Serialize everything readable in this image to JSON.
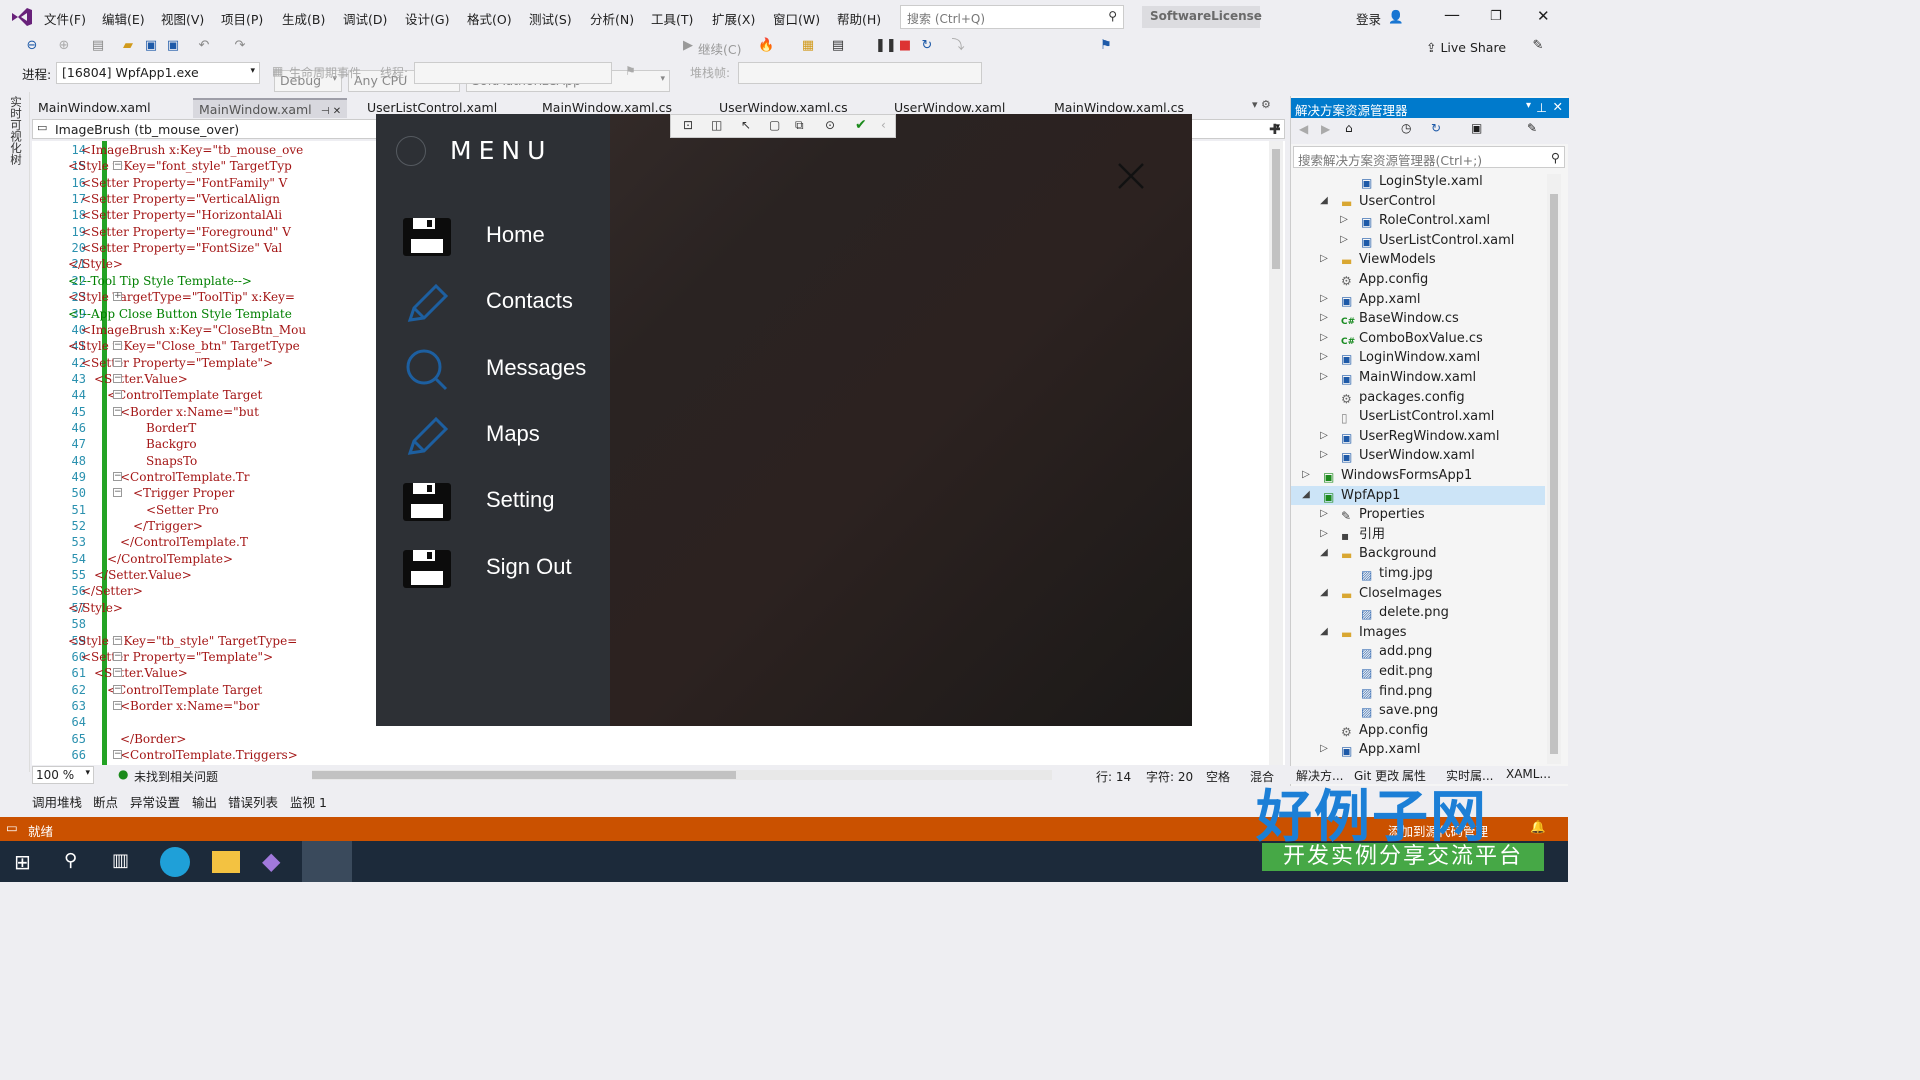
{
  "menubar": {
    "items": [
      "文件(F)",
      "编辑(E)",
      "视图(V)",
      "项目(P)",
      "生成(B)",
      "调试(D)",
      "设计(G)",
      "格式(O)",
      "测试(S)",
      "分析(N)",
      "工具(T)",
      "扩展(X)",
      "窗口(W)",
      "帮助(H)"
    ],
    "search_placeholder": "搜索 (Ctrl+Q)",
    "license": "SoftwareLicense",
    "login": "登录",
    "live_share": "Live Share"
  },
  "toolbar": {
    "config": "Debug",
    "platform": "Any CPU",
    "startup": "SoftAuthorizeApp",
    "continue": "继续(C)",
    "process_label": "进程:",
    "process_value": "[16804] WpfApp1.exe",
    "lifecycle": "生命周期事件",
    "thread_label": "线程:",
    "stack_label": "堆栈帧:"
  },
  "left_strip": {
    "label": "实时可视化树"
  },
  "tabs": [
    {
      "label": "MainWindow.xaml",
      "active": false
    },
    {
      "label": "MainWindow.xaml",
      "active": true
    },
    {
      "label": "UserListControl.xaml",
      "active": false
    },
    {
      "label": "MainWindow.xaml.cs",
      "active": false
    },
    {
      "label": "UserWindow.xaml.cs",
      "active": false
    },
    {
      "label": "UserWindow.xaml",
      "active": false
    },
    {
      "label": "MainWindow.xaml.cs",
      "active": false
    }
  ],
  "navbar": {
    "scope": "ImageBrush (tb_mouse_over)"
  },
  "code_lines": [
    {
      "n": "14",
      "indent": 3,
      "text": "<ImageBrush x:Key=\"tb_mouse_ove"
    },
    {
      "n": "15",
      "indent": 2,
      "text": "<Style x:Key=\"font_style\" TargetTyp"
    },
    {
      "n": "16",
      "indent": 3,
      "text": "<Setter Property=\"FontFamily\" V"
    },
    {
      "n": "17",
      "indent": 3,
      "text": "<Setter Property=\"VerticalAlign"
    },
    {
      "n": "18",
      "indent": 3,
      "text": "<Setter Property=\"HorizontalAli"
    },
    {
      "n": "19",
      "indent": 3,
      "text": "<Setter Property=\"Foreground\" V"
    },
    {
      "n": "20",
      "indent": 3,
      "text": "<Setter Property=\"FontSize\" Val"
    },
    {
      "n": "21",
      "indent": 2,
      "text": "</Style>"
    },
    {
      "n": "22",
      "indent": 2,
      "text": "<!--Tool Tip Style Template-->"
    },
    {
      "n": "23",
      "indent": 2,
      "text": "<Style TargetType=\"ToolTip\" x:Key="
    },
    {
      "n": "39",
      "indent": 2,
      "text": "<!--App Close Button Style Template"
    },
    {
      "n": "40",
      "indent": 3,
      "text": "<ImageBrush x:Key=\"CloseBtn_Mou"
    },
    {
      "n": "41",
      "indent": 2,
      "text": "<Style x:Key=\"Close_btn\" TargetType"
    },
    {
      "n": "42",
      "indent": 3,
      "text": "<Setter Property=\"Template\">"
    },
    {
      "n": "43",
      "indent": 4,
      "text": "<Setter.Value>"
    },
    {
      "n": "44",
      "indent": 5,
      "text": "<ControlTemplate Target"
    },
    {
      "n": "45",
      "indent": 6,
      "text": "<Border x:Name=\"but"
    },
    {
      "n": "46",
      "indent": 8,
      "text": "BorderT"
    },
    {
      "n": "47",
      "indent": 8,
      "text": "Backgro"
    },
    {
      "n": "48",
      "indent": 8,
      "text": "SnapsTo"
    },
    {
      "n": "49",
      "indent": 6,
      "text": "<ControlTemplate.Tr"
    },
    {
      "n": "50",
      "indent": 7,
      "text": "<Trigger Proper"
    },
    {
      "n": "51",
      "indent": 8,
      "text": "<Setter Pro"
    },
    {
      "n": "52",
      "indent": 7,
      "text": "</Trigger>"
    },
    {
      "n": "53",
      "indent": 6,
      "text": "</ControlTemplate.T"
    },
    {
      "n": "54",
      "indent": 5,
      "text": "</ControlTemplate>"
    },
    {
      "n": "55",
      "indent": 4,
      "text": "</Setter.Value>"
    },
    {
      "n": "56",
      "indent": 3,
      "text": "</Setter>"
    },
    {
      "n": "57",
      "indent": 2,
      "text": "</Style>"
    },
    {
      "n": "58",
      "indent": 2,
      "text": ""
    },
    {
      "n": "59",
      "indent": 2,
      "text": "<Style x:Key=\"tb_style\" TargetType="
    },
    {
      "n": "60",
      "indent": 3,
      "text": "<Setter Property=\"Template\">"
    },
    {
      "n": "61",
      "indent": 4,
      "text": "<Setter.Value>"
    },
    {
      "n": "62",
      "indent": 5,
      "text": "<ControlTemplate Target"
    },
    {
      "n": "63",
      "indent": 6,
      "text": "<Border x:Name=\"bor"
    },
    {
      "n": "64",
      "indent": 6,
      "text": ""
    },
    {
      "n": "65",
      "indent": 6,
      "text": "</Border>"
    },
    {
      "n": "66",
      "indent": 6,
      "text": "<ControlTemplate.Triggers>"
    }
  ],
  "editor_status": {
    "zoom": "100 %",
    "issues": "未找到相关问题",
    "line": "行: 14",
    "char": "字符: 20",
    "space": "空格",
    "mixed": "混合"
  },
  "bottom_tabs": [
    "调用堆栈",
    "断点",
    "异常设置",
    "输出",
    "错误列表",
    "监视 1"
  ],
  "statusbar": {
    "ready": "就绪",
    "add_source": "添加到源代码管理"
  },
  "solution": {
    "title": "解决方案资源管理器",
    "search_placeholder": "搜索解决方案资源管理器(Ctrl+;)",
    "tabs": [
      "解决方...",
      "Git 更改",
      "属性",
      "实时属...",
      "XAML..."
    ],
    "nodes": [
      {
        "label": "LoginStyle.xaml",
        "level": 4,
        "arrow": "",
        "icon": "xaml"
      },
      {
        "label": "UserControl",
        "level": 3,
        "arrow": "open",
        "icon": "folder"
      },
      {
        "label": "RoleControl.xaml",
        "level": 4,
        "arrow": "closed",
        "icon": "xaml"
      },
      {
        "label": "UserListControl.xaml",
        "level": 4,
        "arrow": "closed",
        "icon": "xaml"
      },
      {
        "label": "ViewModels",
        "level": 3,
        "arrow": "closed",
        "icon": "folder"
      },
      {
        "label": "App.config",
        "level": 3,
        "arrow": "",
        "icon": "config"
      },
      {
        "label": "App.xaml",
        "level": 3,
        "arrow": "closed",
        "icon": "xaml"
      },
      {
        "label": "BaseWindow.cs",
        "level": 3,
        "arrow": "closed",
        "icon": "cs"
      },
      {
        "label": "ComboBoxValue.cs",
        "level": 3,
        "arrow": "closed",
        "icon": "cs"
      },
      {
        "label": "LoginWindow.xaml",
        "level": 3,
        "arrow": "closed",
        "icon": "xaml"
      },
      {
        "label": "MainWindow.xaml",
        "level": 3,
        "arrow": "closed",
        "icon": "xaml"
      },
      {
        "label": "packages.config",
        "level": 3,
        "arrow": "",
        "icon": "config"
      },
      {
        "label": "UserListControl.xaml",
        "level": 3,
        "arrow": "",
        "icon": "file"
      },
      {
        "label": "UserRegWindow.xaml",
        "level": 3,
        "arrow": "closed",
        "icon": "xaml"
      },
      {
        "label": "UserWindow.xaml",
        "level": 3,
        "arrow": "closed",
        "icon": "xaml"
      },
      {
        "label": "WindowsFormsApp1",
        "level": 2,
        "arrow": "closed",
        "icon": "project"
      },
      {
        "label": "WpfApp1",
        "level": 2,
        "arrow": "open",
        "icon": "project",
        "selected": true
      },
      {
        "label": "Properties",
        "level": 3,
        "arrow": "closed",
        "icon": "wrench"
      },
      {
        "label": "引用",
        "level": 3,
        "arrow": "closed",
        "icon": "ref"
      },
      {
        "label": "Background",
        "level": 3,
        "arrow": "open",
        "icon": "folder"
      },
      {
        "label": "timg.jpg",
        "level": 4,
        "arrow": "",
        "icon": "image"
      },
      {
        "label": "CloseImages",
        "level": 3,
        "arrow": "open",
        "icon": "folder"
      },
      {
        "label": "delete.png",
        "level": 4,
        "arrow": "",
        "icon": "image"
      },
      {
        "label": "Images",
        "level": 3,
        "arrow": "open",
        "icon": "folder"
      },
      {
        "label": "add.png",
        "level": 4,
        "arrow": "",
        "icon": "image"
      },
      {
        "label": "edit.png",
        "level": 4,
        "arrow": "",
        "icon": "image"
      },
      {
        "label": "find.png",
        "level": 4,
        "arrow": "",
        "icon": "image"
      },
      {
        "label": "save.png",
        "level": 4,
        "arrow": "",
        "icon": "image"
      },
      {
        "label": "App.config",
        "level": 3,
        "arrow": "",
        "icon": "config"
      },
      {
        "label": "App.xaml",
        "level": 3,
        "arrow": "closed",
        "icon": "xaml"
      }
    ]
  },
  "wpf_app": {
    "menu_title": "MENU",
    "items": [
      {
        "label": "Home",
        "icon": "floppy-icon"
      },
      {
        "label": "Contacts",
        "icon": "pencil-icon"
      },
      {
        "label": "Messages",
        "icon": "magnifier-icon"
      },
      {
        "label": "Maps",
        "icon": "pencil-icon"
      },
      {
        "label": "Setting",
        "icon": "floppy-icon"
      },
      {
        "label": "Sign Out",
        "icon": "floppy-icon"
      }
    ]
  },
  "watermark": {
    "brand": "好例子网",
    "sub": "开发实例分享交流平台"
  },
  "colors": {
    "accent": "#007acc",
    "status": "#ca5100",
    "git": "#23a324",
    "menu_bg": "#2d3035"
  }
}
